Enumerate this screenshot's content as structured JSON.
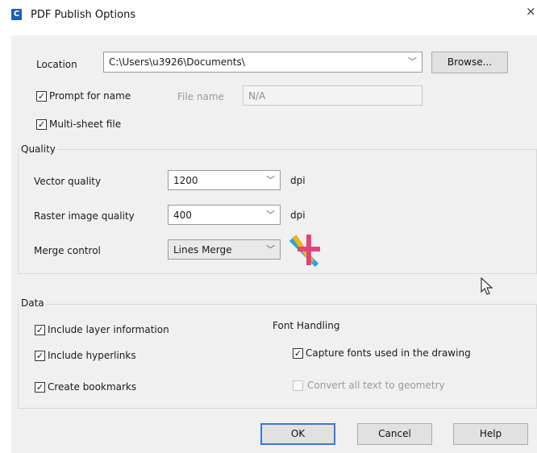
{
  "window": {
    "app_icon_letter": "C",
    "title": "PDF Publish Options",
    "close": "×"
  },
  "location": {
    "label": "Location",
    "value": "C:\\Users\\u3926\\Documents\\",
    "browse": "Browse..."
  },
  "prompt_for_name": {
    "label": "Prompt for name",
    "checked": true
  },
  "file_name": {
    "label": "File name",
    "value": "N/A"
  },
  "multi_sheet": {
    "label": "Multi-sheet file",
    "checked": true
  },
  "quality": {
    "title": "Quality",
    "vector": {
      "label": "Vector quality",
      "value": "1200",
      "unit": "dpi"
    },
    "raster": {
      "label": "Raster image quality",
      "value": "400",
      "unit": "dpi"
    },
    "merge": {
      "label": "Merge control",
      "value": "Lines Merge"
    }
  },
  "data": {
    "title": "Data",
    "include_layer": {
      "label": "Include layer information",
      "checked": true
    },
    "include_hyperlinks": {
      "label": "Include hyperlinks",
      "checked": true
    },
    "create_bookmarks": {
      "label": "Create bookmarks",
      "checked": true
    },
    "font_handling": {
      "title": "Font Handling",
      "capture_fonts": {
        "label": "Capture fonts used in the drawing",
        "checked": true
      },
      "convert_text": {
        "label": "Convert all text to geometry",
        "checked": false,
        "disabled": true
      }
    }
  },
  "buttons": {
    "ok": "OK",
    "cancel": "Cancel",
    "help": "Help"
  },
  "colors": {
    "focus_border": "#3b78d6",
    "app_icon": "#1b5fb5"
  }
}
